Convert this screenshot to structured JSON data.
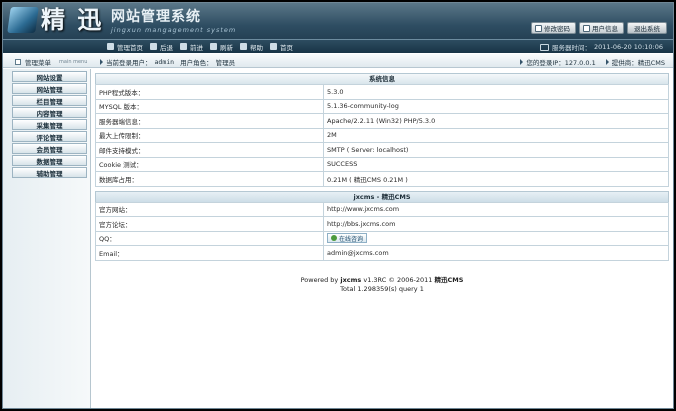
{
  "header": {
    "logo_cn": "精 迅",
    "logo_title": "网站管理系统",
    "logo_subtitle": "jingxun mangagement system",
    "actions": [
      {
        "label": "修改密码",
        "icon": "key-icon"
      },
      {
        "label": "用户信息",
        "icon": "user-icon"
      },
      {
        "label": "退出系统",
        "icon": ""
      }
    ]
  },
  "nav": {
    "items": [
      {
        "label": "管理首页"
      },
      {
        "label": "后退"
      },
      {
        "label": "前进"
      },
      {
        "label": "刷新"
      },
      {
        "label": "帮助"
      },
      {
        "label": "首页"
      }
    ],
    "server_time_label": "服务器时间：",
    "server_time_value": "2011-06-20 10:10:06"
  },
  "infobar": {
    "menu_title": "管理菜单",
    "menu_title_en": "main menu",
    "current_user_label": "当前登录用户：",
    "current_user": "admin",
    "role_label": "用户角色：",
    "role": "管理员",
    "ip_label": "您的登录IP：",
    "ip": "127.0.0.1",
    "provider_label": "提供商：",
    "provider": "精迅CMS"
  },
  "sidebar": {
    "items": [
      "网站设置",
      "网站管理",
      "栏目管理",
      "内容管理",
      "采集管理",
      "评论管理",
      "会员管理",
      "数据管理",
      "辅助管理"
    ]
  },
  "system_info": {
    "title": "系统信息",
    "rows": [
      {
        "key": "PHP程式版本：",
        "value": "5.3.0"
      },
      {
        "key": "MYSQL 版本：",
        "value": "5.1.36-community-log"
      },
      {
        "key": "服务器端信息：",
        "value": "Apache/2.2.11 (Win32) PHP/5.3.0"
      },
      {
        "key": "最大上传限制：",
        "value": "2M"
      },
      {
        "key": "邮件支持模式：",
        "value": "SMTP ( Server: localhost)"
      },
      {
        "key": "Cookie 测试：",
        "value": "SUCCESS"
      },
      {
        "key": "数据库占用：",
        "value": "0.21M ( 精迅CMS 0.21M )"
      }
    ]
  },
  "jxcms_info": {
    "title": "jxcms - 精迅CMS",
    "rows": [
      {
        "key": "官方网站：",
        "value": "http://www.jxcms.com"
      },
      {
        "key": "官方论坛：",
        "value": "http://bbs.jxcms.com"
      },
      {
        "key": "QQ：",
        "value": "在线咨询"
      },
      {
        "key": "Email：",
        "value": "admin@jxcms.com"
      }
    ]
  },
  "footer": {
    "powered_by": "Powered by",
    "brand": "jxcms",
    "version": "v1.3RC",
    "copyright": "© 2006-2011",
    "brand_cn": "精迅CMS",
    "stats": "Total 1.298359(s) query 1"
  }
}
